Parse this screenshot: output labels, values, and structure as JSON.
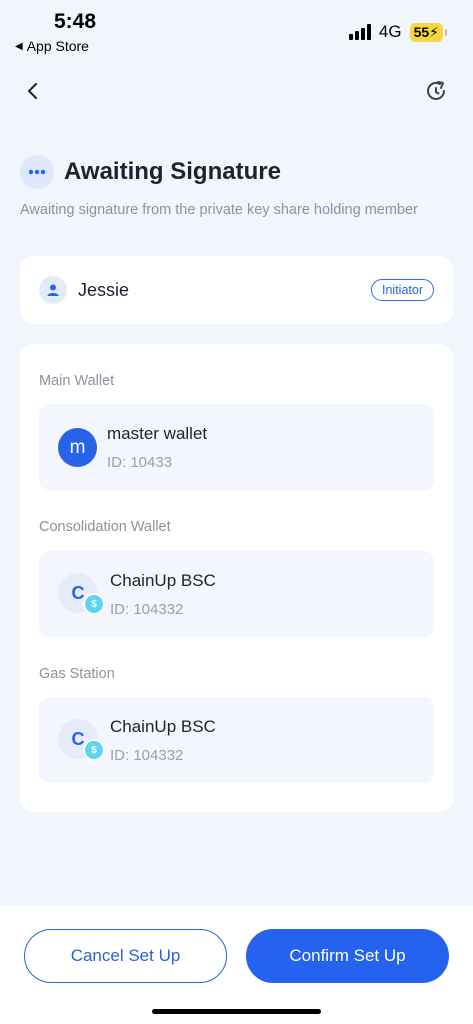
{
  "status_bar": {
    "time": "5:48",
    "back_app": "App Store",
    "network": "4G",
    "battery": "55"
  },
  "nav": {
    "back_icon": "chevron-left-icon",
    "refresh_icon": "refresh-icon"
  },
  "header": {
    "title": "Awaiting Signature",
    "subtitle": "Awaiting signature from the private key share holding member",
    "status_icon": "more-dots-icon"
  },
  "initiator": {
    "name": "Jessie",
    "badge": "Initiator",
    "icon": "user-icon"
  },
  "wallets": {
    "main": {
      "label": "Main Wallet",
      "avatar_letter": "m",
      "name": "master wallet",
      "id": "ID: 10433"
    },
    "consolidation": {
      "label": "Consolidation Wallet",
      "avatar_letter": "C",
      "name": "ChainUp BSC",
      "id": "ID: 104332"
    },
    "gas": {
      "label": "Gas Station",
      "avatar_letter": "C",
      "name": "ChainUp BSC",
      "id": "ID: 104332"
    }
  },
  "footer": {
    "cancel_label": "Cancel Set Up",
    "confirm_label": "Confirm Set Up"
  },
  "colors": {
    "accent": "#2462ef",
    "background": "#f1f5fc",
    "card": "#ffffff",
    "muted_text": "#8c939f"
  }
}
